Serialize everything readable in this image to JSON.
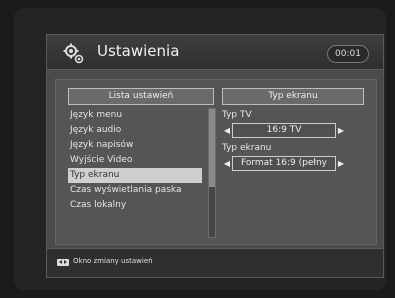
{
  "header": {
    "title": "Ustawienia",
    "clock": "00:01",
    "icon": "gear-icon"
  },
  "left_panel": {
    "header": "Lista ustawień",
    "items": [
      {
        "label": "Język menu",
        "selected": false
      },
      {
        "label": "Język audio",
        "selected": false
      },
      {
        "label": "Język napisów",
        "selected": false
      },
      {
        "label": "Wyjście Video",
        "selected": false
      },
      {
        "label": "Typ ekranu",
        "selected": true
      },
      {
        "label": "Czas wyświetlania paska",
        "selected": false
      },
      {
        "label": "Czas lokalny",
        "selected": false
      }
    ]
  },
  "right_panel": {
    "header": "Typ ekranu",
    "fields": [
      {
        "label": "Typ TV",
        "value": "16:9 TV"
      },
      {
        "label": "Typ ekranu",
        "value": "Format 16:9 (pełny"
      }
    ]
  },
  "footer": {
    "hint": "Okno zmiany ustawień",
    "icon": "left-right-keys-icon"
  }
}
